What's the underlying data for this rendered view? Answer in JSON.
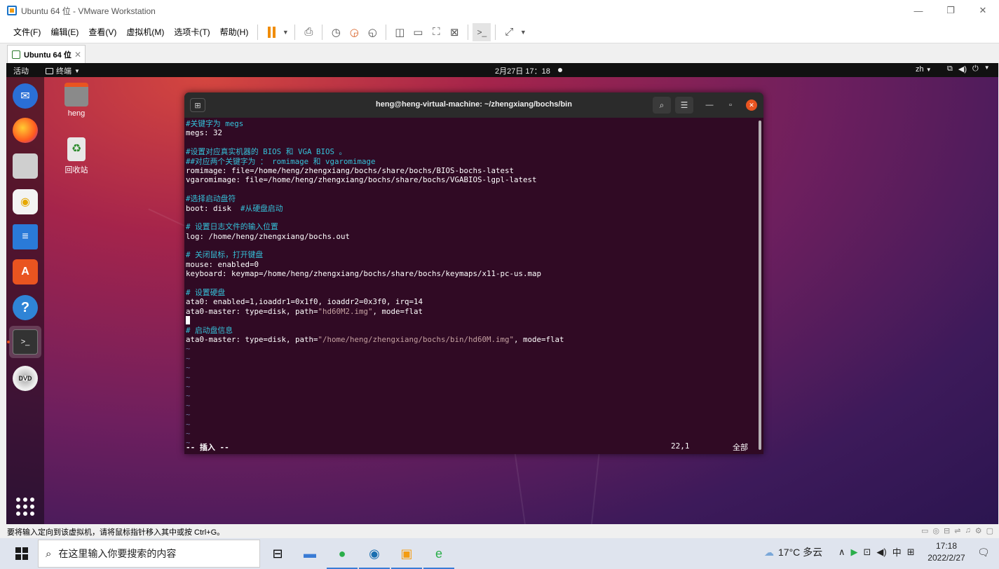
{
  "vmware": {
    "window_title": "Ubuntu 64 位 - VMware Workstation",
    "menu": [
      "文件(F)",
      "编辑(E)",
      "查看(V)",
      "虚拟机(M)",
      "选项卡(T)",
      "帮助(H)"
    ],
    "tab_label": "Ubuntu 64 位",
    "status_message": "要将输入定向到该虚拟机，请将鼠标指针移入其中或按 Ctrl+G。"
  },
  "gnome": {
    "activities": "活动",
    "app_menu": "终端",
    "clock": "2月27日 17：18",
    "lang": "zh",
    "tray_icons": [
      "network-icon",
      "volume-icon",
      "power-icon"
    ]
  },
  "desktop": {
    "icons": [
      {
        "label": "heng",
        "icon": "home-folder-icon"
      },
      {
        "label": "回收站",
        "icon": "trash-icon"
      }
    ],
    "dock": [
      "thunderbird-icon",
      "firefox-icon",
      "files-icon",
      "rhythmbox-icon",
      "libreoffice-writer-icon",
      "software-center-icon",
      "help-icon",
      "terminal-icon",
      "dvd-icon",
      "show-apps-icon"
    ]
  },
  "terminal": {
    "title": "heng@heng-virtual-machine: ~/zhengxiang/bochs/bin",
    "lines": [
      {
        "type": "comment",
        "text": "#关键字为 megs"
      },
      {
        "type": "plain",
        "text": "megs: 32"
      },
      {
        "type": "blank",
        "text": ""
      },
      {
        "type": "comment",
        "text": "#设置对应真实机器的 BIOS 和 VGA BIOS 。"
      },
      {
        "type": "comment",
        "text": "##对应两个关键字为 ： romimage 和 vgaromimage"
      },
      {
        "type": "plain",
        "text": "romimage: file=/home/heng/zhengxiang/bochs/share/bochs/BIOS-bochs-latest"
      },
      {
        "type": "plain",
        "text": "vgaromimage: file=/home/heng/zhengxiang/bochs/share/bochs/VGABIOS-lgpl-latest"
      },
      {
        "type": "blank",
        "text": ""
      },
      {
        "type": "comment",
        "text": "#选择启动盘符"
      },
      {
        "type": "mixed",
        "text": "boot: disk",
        "comment": "#从硬盘启动"
      },
      {
        "type": "blank",
        "text": ""
      },
      {
        "type": "comment",
        "text": "# 设置日志文件的输入位置"
      },
      {
        "type": "plain",
        "text": "log: /home/heng/zhengxiang/bochs.out"
      },
      {
        "type": "blank",
        "text": ""
      },
      {
        "type": "comment",
        "text": "# 关闭鼠标，打开键盘"
      },
      {
        "type": "plain",
        "text": "mouse: enabled=0"
      },
      {
        "type": "plain",
        "text": "keyboard: keymap=/home/heng/zhengxiang/bochs/share/bochs/keymaps/x11-pc-us.map"
      },
      {
        "type": "blank",
        "text": ""
      },
      {
        "type": "comment",
        "text": "# 设置硬盘"
      },
      {
        "type": "plain",
        "text": "ata0: enabled=1,ioaddr1=0x1f0, ioaddr2=0x3f0, irq=14"
      },
      {
        "type": "path",
        "pre": "ata0-master: type=disk, path=",
        "str": "\"hd60M2.img\"",
        "post": ", mode=flat"
      },
      {
        "type": "cursor",
        "text": ""
      },
      {
        "type": "comment",
        "text": "# 启动盘信息"
      },
      {
        "type": "path",
        "pre": "ata0-master: type=disk, path=",
        "str": "\"/home/heng/zhengxiang/bochs/bin/hd60M.img\"",
        "post": ", mode=flat"
      },
      {
        "type": "tilde",
        "text": "~"
      },
      {
        "type": "tilde",
        "text": "~"
      },
      {
        "type": "tilde",
        "text": "~"
      },
      {
        "type": "tilde",
        "text": "~"
      },
      {
        "type": "tilde",
        "text": "~"
      },
      {
        "type": "tilde",
        "text": "~"
      },
      {
        "type": "tilde",
        "text": "~"
      },
      {
        "type": "tilde",
        "text": "~"
      },
      {
        "type": "tilde",
        "text": "~"
      },
      {
        "type": "tilde",
        "text": "~"
      },
      {
        "type": "tilde",
        "text": "~"
      }
    ],
    "status_mode": "-- 插入 --",
    "status_pos": "22,1",
    "status_all": "全部",
    "colors": {
      "bg": "#300a24",
      "comment": "#35c1d9",
      "string": "#c4a0a0"
    }
  },
  "taskbar": {
    "search_placeholder": "在这里输入你要搜索的内容",
    "apps": [
      "task-view-icon",
      "explorer-icon",
      "wechat-icon",
      "app-ring-icon",
      "vmware-icon",
      "ie-icon"
    ],
    "weather": "17°C  多云",
    "ime": "中",
    "time": "17:18",
    "date": "2022/2/27"
  }
}
